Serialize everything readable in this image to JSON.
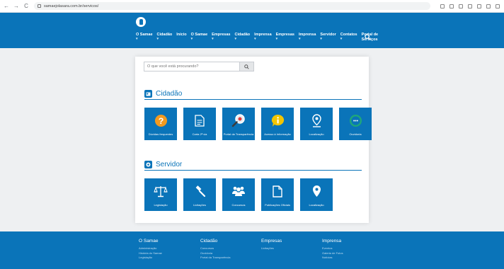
{
  "browser": {
    "url": "samaejolasara.com.br/servicos/",
    "back_glyph": "←",
    "forward_glyph": "→",
    "reload_glyph": "C"
  },
  "header": {
    "nav": [
      {
        "label": "O Samae",
        "marker": "▾"
      },
      {
        "label": "Cidadão",
        "marker": "▾"
      },
      {
        "label": "Início",
        "marker": ""
      },
      {
        "label": "O Samae",
        "marker": "▾"
      },
      {
        "label": "Empresas",
        "marker": "▾"
      },
      {
        "label": "Cidadão",
        "marker": "▾"
      },
      {
        "label": "Imprensa",
        "marker": "▾"
      },
      {
        "label": "Empresas",
        "marker": "▾"
      },
      {
        "label": "Imprensa",
        "marker": "▾"
      },
      {
        "label": "Servidor",
        "marker": "▾"
      },
      {
        "label": "Contatos",
        "marker": "▾"
      },
      {
        "label": "Portal de Serviços",
        "marker": ""
      }
    ]
  },
  "search": {
    "placeholder": "O que você está procurando?",
    "value": ""
  },
  "cidadao": {
    "title": "Cidadão",
    "tiles": [
      {
        "label": "Dúvidas frequentes",
        "icon": "question-icon"
      },
      {
        "label": "Carta 2ª via",
        "icon": "document-icon"
      },
      {
        "label": "Portal da Transparência",
        "icon": "magnifier-icon"
      },
      {
        "label": "Acesso à Informação",
        "icon": "info-icon"
      },
      {
        "label": "Localização",
        "icon": "map-pin-icon"
      },
      {
        "label": "Ouvidoria",
        "icon": "chat-icon"
      }
    ]
  },
  "servidor": {
    "title": "Servidor",
    "tiles": [
      {
        "label": "Legislação",
        "icon": "scales-icon"
      },
      {
        "label": "Licitações",
        "icon": "gavel-icon"
      },
      {
        "label": "Concursos",
        "icon": "people-icon"
      },
      {
        "label": "Publicações Oficiais",
        "icon": "file-icon"
      },
      {
        "label": "Localização",
        "icon": "location-icon"
      }
    ]
  },
  "footer": {
    "columns": [
      {
        "title": "O Samae",
        "links": [
          "Administração",
          "História do Samae",
          "Legislação"
        ]
      },
      {
        "title": "Cidadão",
        "links": [
          "Concursos",
          "Ouvidoria",
          "Portal da Transparência"
        ]
      },
      {
        "title": "Empresas",
        "links": [
          "Licitações"
        ]
      },
      {
        "title": "Imprensa",
        "links": [
          "Eventos",
          "Galeria de Fotos",
          "Notícias"
        ]
      }
    ]
  },
  "colors": {
    "brand": "#0a74b9",
    "question": "#f29a1f",
    "info": "#f2c500",
    "chat": "#1fa77a"
  }
}
